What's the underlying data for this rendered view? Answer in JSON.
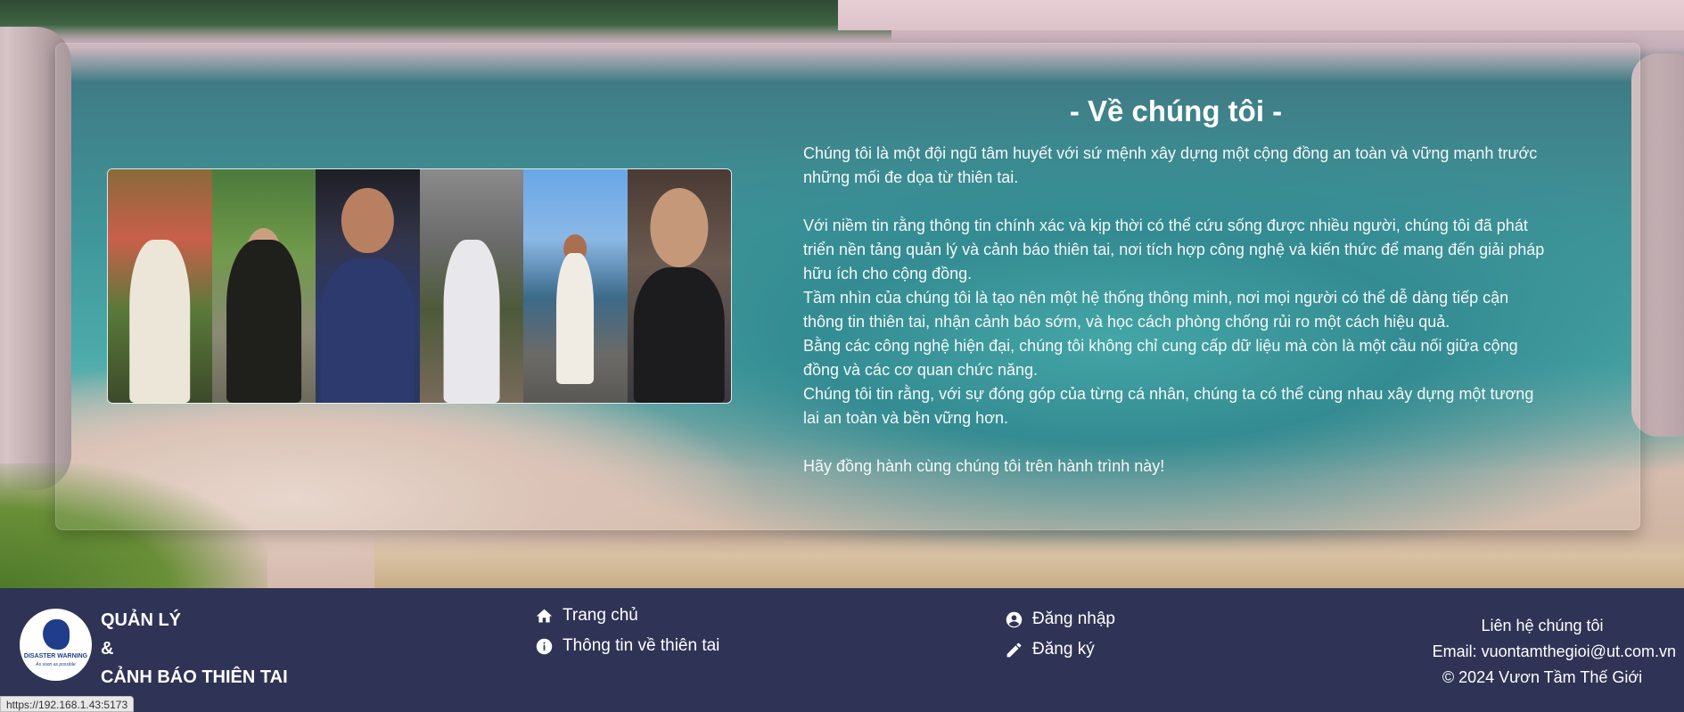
{
  "about": {
    "title": "- Về chúng tôi -",
    "paragraphs": [
      "Chúng tôi là một đội ngũ tâm huyết với sứ mệnh xây dựng một cộng đồng an toàn và vững mạnh trước những mối đe dọa từ thiên tai.",
      "Với niềm tin rằng thông tin chính xác và kịp thời có thể cứu sống được nhiều người, chúng tôi đã phát triển nền tảng quản lý và cảnh báo thiên tai, nơi tích hợp công nghệ và kiến thức để mang đến giải pháp hữu ích cho cộng đồng.",
      "Tầm nhìn của chúng tôi là tạo nên một hệ thống thông minh, nơi mọi người có thể dễ dàng tiếp cận thông tin thiên tai, nhận cảnh báo sớm, và học cách phòng chống rủi ro một cách hiệu quả.",
      "Bằng các công nghệ hiện đại, chúng tôi không chỉ cung cấp dữ liệu mà còn là một cầu nối giữa cộng đồng và các cơ quan chức năng.",
      "Chúng tôi tin rằng, với sự đóng góp của từng cá nhân, chúng ta có thể cùng nhau xây dựng một tương lai an toàn và bền vững hơn.",
      "Hãy đồng hành cùng chúng tôi trên hành trình này!"
    ]
  },
  "footer": {
    "logo": {
      "text": "DISASTER WARNING",
      "tagline": "As soon as possible"
    },
    "brand": {
      "line1": "QUẢN LÝ",
      "line2": "&",
      "line3": "CẢNH BÁO THIÊN TAI"
    },
    "nav_main": {
      "home": "Trang chủ",
      "info": "Thông tin về thiên tai"
    },
    "nav_account": {
      "login": "Đăng nhập",
      "register": "Đăng ký"
    },
    "contact": {
      "heading": "Liên hệ chúng tôi",
      "email": "Email: vuontamthegioi@ut.com.vn",
      "copyright": "© 2024 Vươn Tầm Thế Giới"
    }
  },
  "status_url": "https://192.168.1.43:5173"
}
